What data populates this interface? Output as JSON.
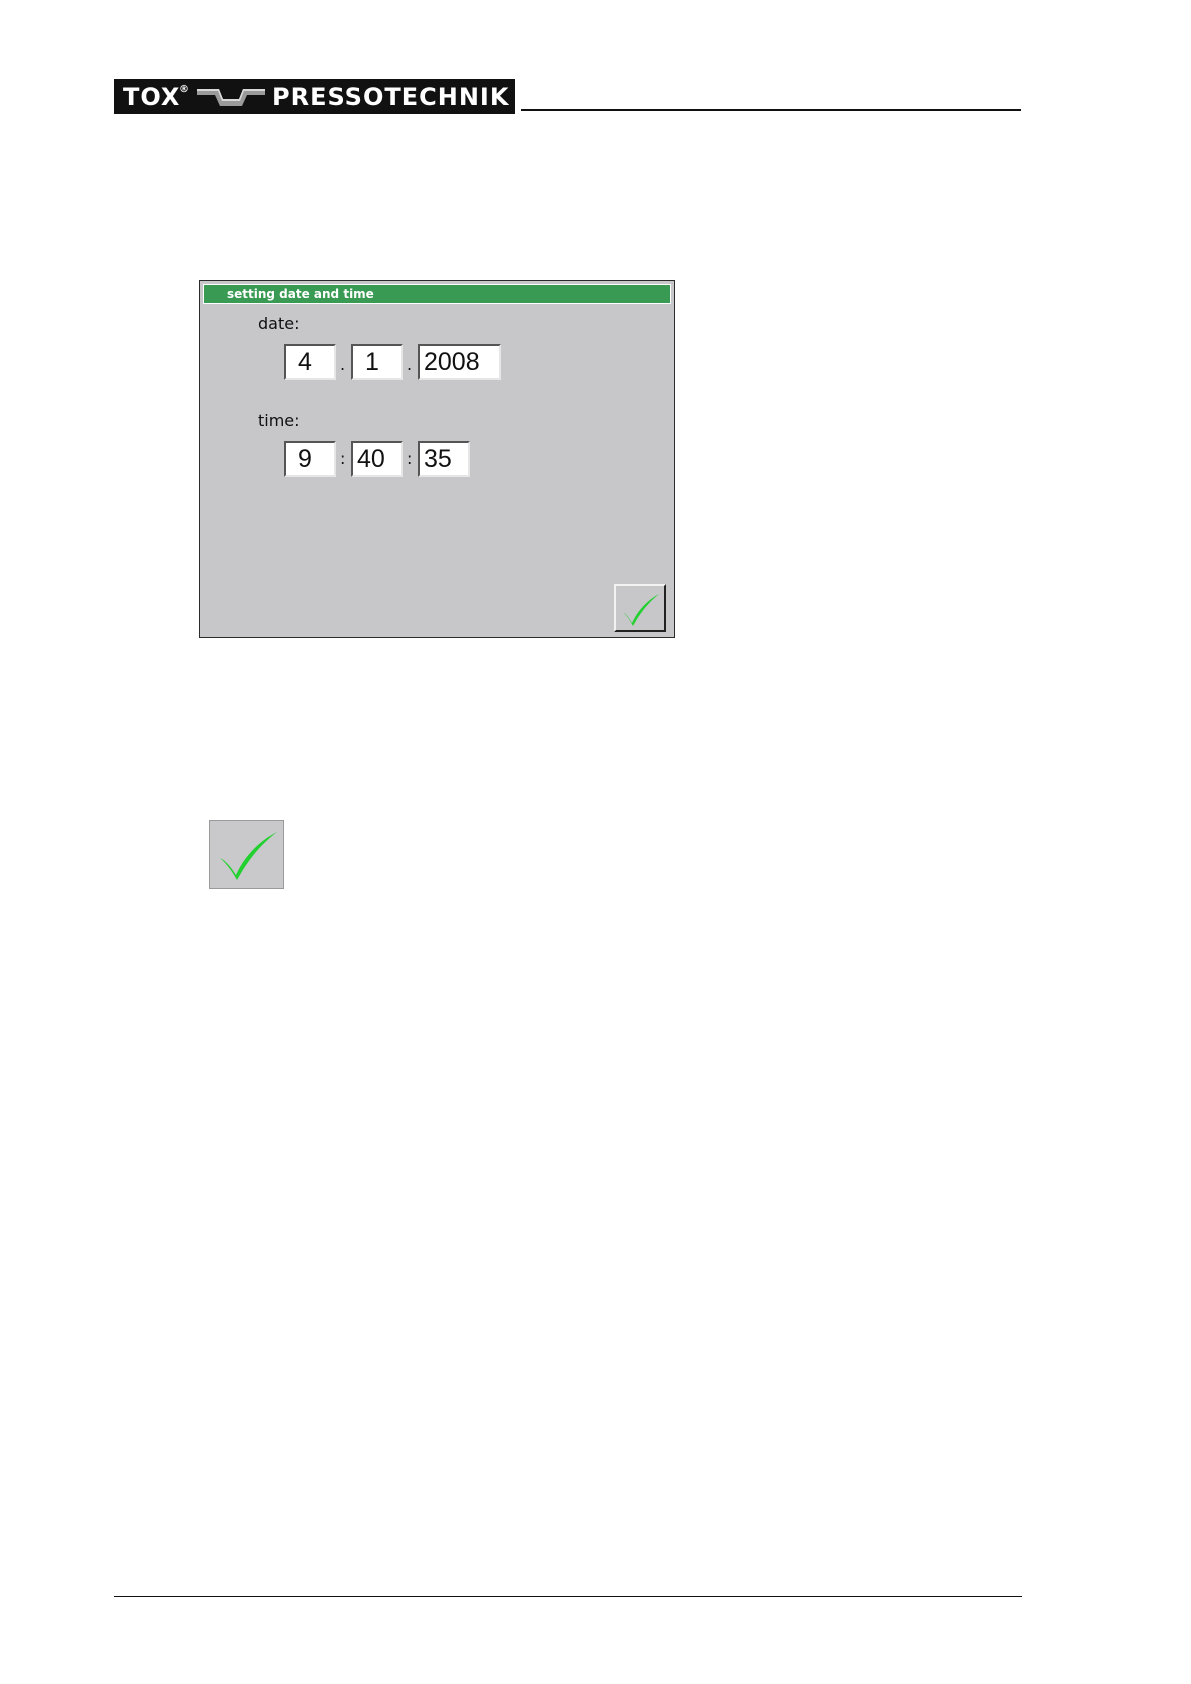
{
  "header": {
    "brand_left": "TOX",
    "brand_reg": "®",
    "brand_right": "PRESSOTECHNIK"
  },
  "dialog": {
    "title": "setting date and time",
    "date_label": "date:",
    "date": {
      "day": "4",
      "month": "1",
      "year": "2008"
    },
    "date_separator": ".",
    "time_label": "time:",
    "time": {
      "hour": "9",
      "minute": "40",
      "second": "35"
    },
    "time_separator": ":",
    "confirm_icon": "checkmark-icon"
  },
  "legend": {
    "confirm_icon": "checkmark-icon"
  },
  "colors": {
    "titlebar": "#399a54",
    "dialog_bg": "#c7c6c9",
    "checkmark": "#22d12f"
  }
}
